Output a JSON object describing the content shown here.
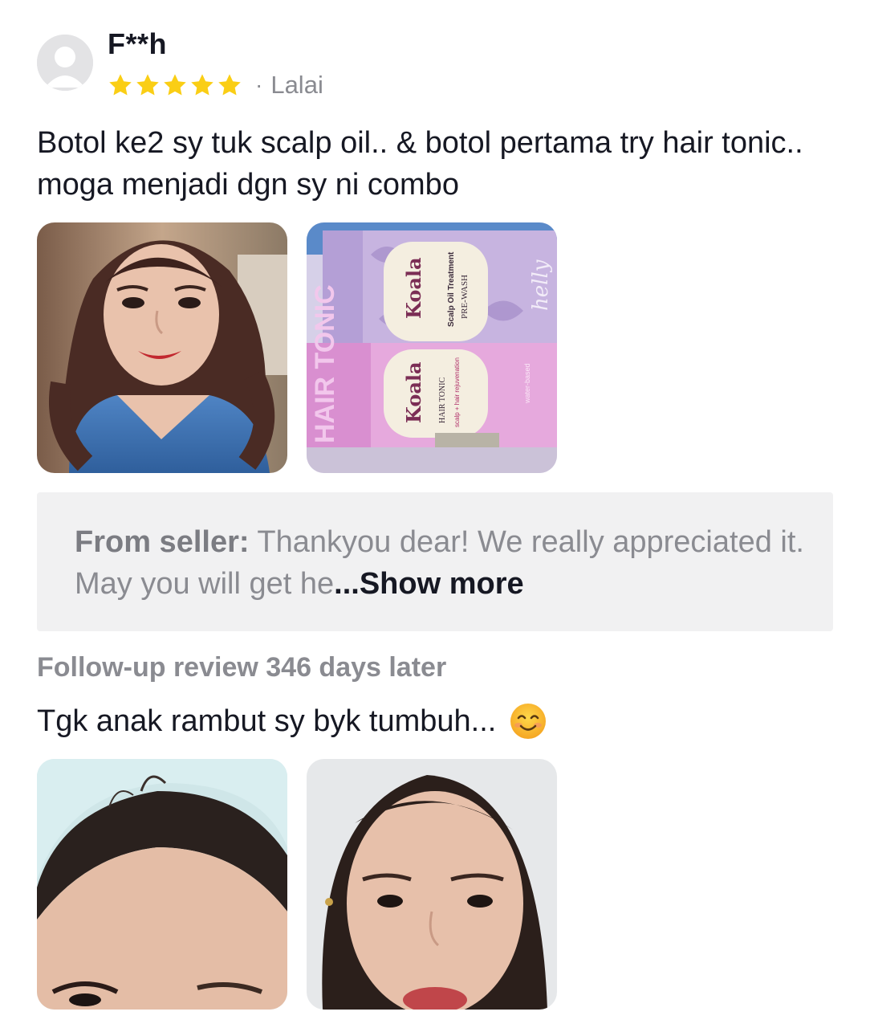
{
  "review": {
    "username": "F**h",
    "rating": 5,
    "rating_max": 5,
    "variant_separator": "·",
    "variant": "Lalai",
    "text": "Botol ke2 sy tuk scalp oil.. & botol pertama try hair tonic.. moga menjadi dgn sy ni combo",
    "photos": [
      {
        "name": "selfie-photo",
        "icon": "portrait-photo"
      },
      {
        "name": "product-photo",
        "icon": "product-boxes-photo"
      }
    ],
    "product_box": {
      "brand": "Koala",
      "box1_title": "Scalp Oil Treatment",
      "box1_subtitle": "PRE-WASH",
      "box2_title": "HAIR TONIC",
      "box2_subtitle": "scalp + hair rejuvenation",
      "side_text": "water-based",
      "side_brand": "helly",
      "big_letters": "HAIR TONIC"
    }
  },
  "seller_reply": {
    "label": "From seller:",
    "text": " Thankyou dear! We really appreciated it. May you will get he",
    "show_more": "...Show more"
  },
  "followup": {
    "label": "Follow-up review 346 days later",
    "text": "Tgk anak rambut sy byk tumbuh...",
    "emoji": "smiling-face-icon",
    "photos": [
      {
        "name": "hairline-photo",
        "icon": "forehead-photo"
      },
      {
        "name": "face-closeup-photo",
        "icon": "face-photo"
      }
    ]
  },
  "colors": {
    "star": "#FACE15",
    "text_primary": "#161823",
    "text_secondary": "#8A8B91",
    "seller_bg": "#F1F1F2"
  }
}
